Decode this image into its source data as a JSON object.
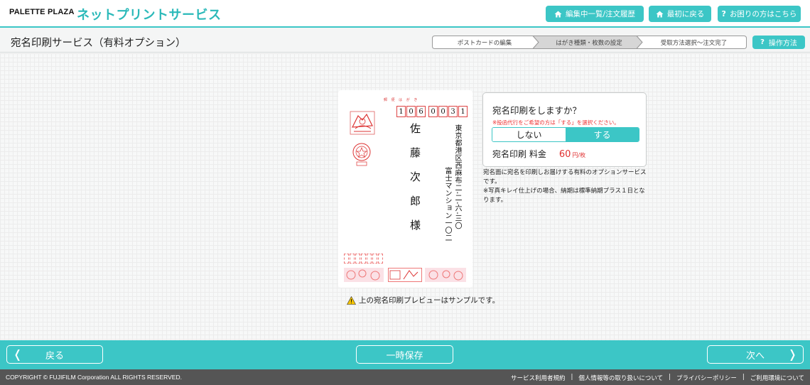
{
  "header": {
    "brand": "PALETTE PLAZA",
    "service": "ネットプリントサービス",
    "buttons": [
      {
        "label": "編集中一覧/注文履歴",
        "icon": "home-icon"
      },
      {
        "label": "最初に戻る",
        "icon": "home-icon"
      },
      {
        "label": "お困りの方はこちら",
        "icon": "question-icon"
      }
    ]
  },
  "subheader": {
    "title": "宛名印刷サービス（有料オプション）",
    "steps": [
      "ポストカードの編集",
      "はがき種類・枚数の設定",
      "受取方法選択～注文完了"
    ],
    "active_step": 1,
    "help_label": "操作方法"
  },
  "postcard": {
    "postal_label": "郵 便 は が き",
    "zip": [
      "1",
      "0",
      "6",
      "0",
      "0",
      "3",
      "1"
    ],
    "name": "佐藤次郎様",
    "address_line1": "東京都港区西麻布二‐二‐六‐三〇",
    "address_line2": "富士マンション一〇二"
  },
  "note": "上の宛名印刷プレビューはサンプルです。",
  "option": {
    "question": "宛名印刷をしますか？",
    "warning": "※投函代行をご希望の方は「する」を選択ください。",
    "toggle_off": "しない",
    "toggle_on": "する",
    "selected": "する",
    "fee_label": "宛名印刷 料金",
    "price": "60",
    "unit": "円/枚",
    "description_1": "宛名面に宛名を印刷しお届けする有料のオプションサービスです。",
    "description_2": "※写真キレイ仕上げの場合、納期は標準納期プラス１日となります。"
  },
  "footer": {
    "back_label": "戻る",
    "save_label": "一時保存",
    "next_label": "次へ",
    "copyright": "COPYRIGHT © FUJIFILM Corporation ALL RIGHTS RESERVED.",
    "links": [
      "サービス利用者規約",
      "個人情報等の取り扱いについて",
      "プライバシーポリシー",
      "ご利用環境について"
    ]
  },
  "colors": {
    "accent": "#3cc6c6",
    "price": "#e03030"
  }
}
